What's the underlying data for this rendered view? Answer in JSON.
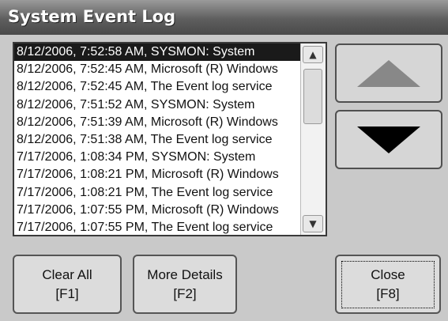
{
  "window": {
    "title": "System Event Log"
  },
  "log": {
    "entries": [
      "8/12/2006, 7:52:58 AM, SYSMON: System",
      "8/12/2006, 7:52:45 AM, Microsoft (R) Windows",
      "8/12/2006, 7:52:45 AM, The Event log service",
      "8/12/2006, 7:51:52 AM, SYSMON: System",
      "8/12/2006, 7:51:39 AM, Microsoft (R) Windows",
      "8/12/2006, 7:51:38 AM, The Event log service",
      "7/17/2006, 1:08:34 PM, SYSMON: System",
      "7/17/2006, 1:08:21 PM, Microsoft (R) Windows",
      "7/17/2006, 1:08:21 PM, The Event log service",
      "7/17/2006, 1:07:55 PM, Microsoft (R) Windows",
      "7/17/2006, 1:07:55 PM, The Event log service"
    ],
    "selected_index": 0
  },
  "buttons": {
    "clear_all": {
      "line1": "Clear All",
      "line2": "[F1]"
    },
    "more_details": {
      "line1": "More Details",
      "line2": "[F2]"
    },
    "close": {
      "line1": "Close",
      "line2": "[F8]"
    }
  },
  "icons": {
    "scroll_up": "up-arrow-icon",
    "scroll_down": "down-arrow-icon"
  },
  "colors": {
    "title_bar": "#5e5e5e",
    "selection": "#1a1a1a",
    "background": "#c9c9c9"
  }
}
